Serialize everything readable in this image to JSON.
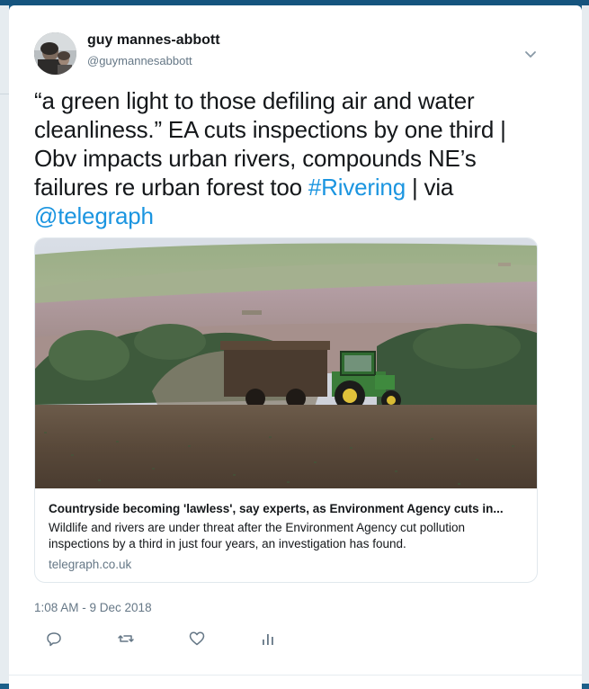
{
  "tweet": {
    "author": {
      "display_name": "guy mannes-abbott",
      "handle": "@guymannesabbott"
    },
    "text_part1": "“a green light to those defiling air and water cleanliness.” EA cuts inspections by one third | Obv impacts urban rivers, compounds NE’s failures re urban forest too ",
    "hashtag": "#Rivering",
    "text_part2": " | via ",
    "mention": "@telegraph",
    "link_card": {
      "title": "Countryside becoming 'lawless', say experts, as Environment Agency cuts in...",
      "description": "Wildlife and rivers are under threat after the Environment Agency cut pollution inspections by a third in just four years, an investigation has found.",
      "domain": "telegraph.co.uk"
    },
    "timestamp": "1:08 AM - 9 Dec 2018"
  },
  "icons": {
    "caret": "chevron-down-icon",
    "reply": "reply-icon",
    "retweet": "retweet-icon",
    "like": "heart-icon",
    "analytics": "analytics-icon"
  },
  "colors": {
    "link": "#1b95e0",
    "text": "#14171a",
    "secondary": "#657786",
    "backdrop": "#1b5f8a"
  }
}
